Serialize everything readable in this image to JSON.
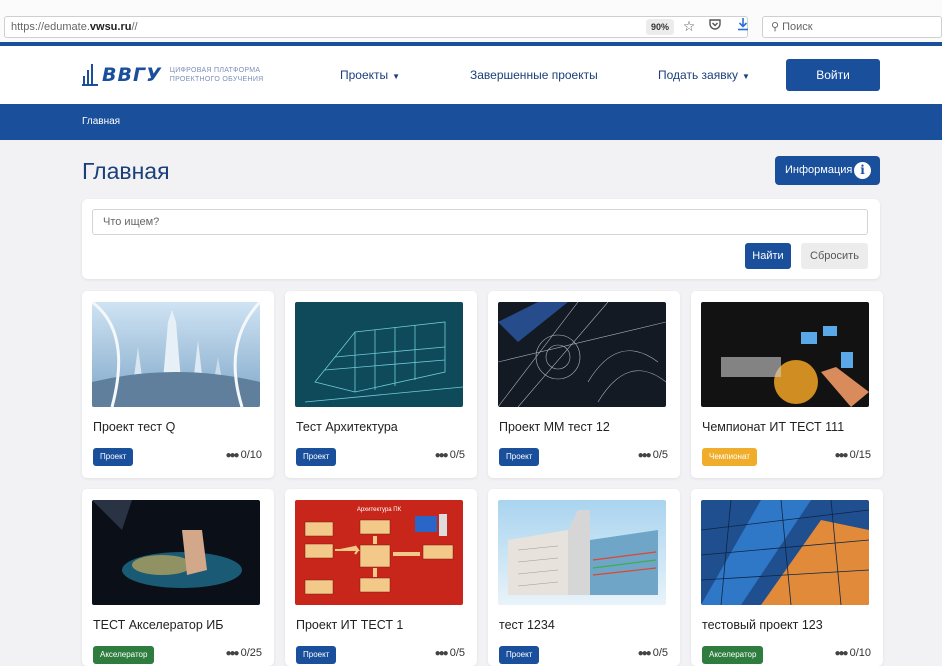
{
  "browser": {
    "url_prefix": "https://edumate.",
    "url_domain": "vwsu.ru",
    "url_suffix": "//",
    "zoom": "90%",
    "search_placeholder": "Поиск"
  },
  "header": {
    "logo_mark": "ВВГУ",
    "logo_line1": "ЦИФРОВАЯ ПЛАТФОРМА",
    "logo_line2": "ПРОЕКТНОГО ОБУЧЕНИЯ",
    "nav_projects": "Проекты",
    "nav_completed": "Завершенные проекты",
    "nav_apply": "Подать заявку",
    "login_label": "Войти"
  },
  "breadcrumb": {
    "home": "Главная"
  },
  "page": {
    "title": "Главная",
    "info_label": "Информация"
  },
  "search": {
    "placeholder": "Что ищем?",
    "find_label": "Найти",
    "reset_label": "Сбросить"
  },
  "colors": {
    "brand": "#1a4f9c",
    "badge_project": "#1a4f9c",
    "badge_championship": "#f0ad2b",
    "badge_accelerator": "#2e7d3f"
  },
  "projects": [
    {
      "title": "Проект тест Q",
      "badge": "Проект",
      "members": "0/10"
    },
    {
      "title": "Тест Архитектура",
      "badge": "Проект",
      "members": "0/5"
    },
    {
      "title": "Проект ММ тест 12",
      "badge": "Проект",
      "members": "0/5"
    },
    {
      "title": "Чемпионат ИТ ТЕСТ 111",
      "badge": "Чемпионат",
      "members": "0/15"
    },
    {
      "title": "ТЕСТ Акселератор ИБ",
      "badge": "Акселератор",
      "members": "0/25"
    },
    {
      "title": "Проект ИТ ТЕСТ 1",
      "badge": "Проект",
      "members": "0/5"
    },
    {
      "title": "тест 1234",
      "badge": "Проект",
      "members": "0/5"
    },
    {
      "title": "тестовый проект 123",
      "badge": "Акселератор",
      "members": "0/10"
    }
  ],
  "thumb_text": {
    "arch_pc": "Архитектура ПК"
  }
}
